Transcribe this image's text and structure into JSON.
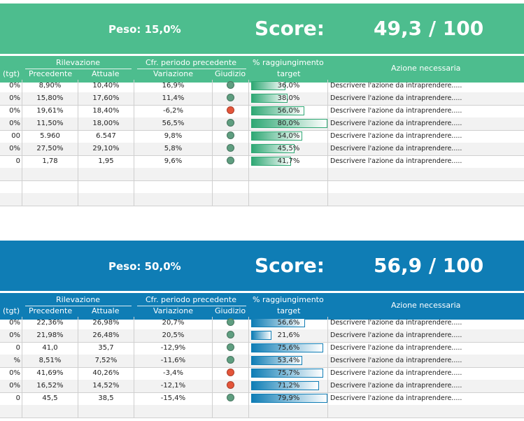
{
  "sections": [
    {
      "banner_color": "#4dbd8e",
      "header_color": "#4dbd8e",
      "peso": "Peso: 15,0%",
      "score_label": "Score:",
      "score_value": "49,3 / 100",
      "headers": {
        "col0": "(tgt)",
        "rilevazione": "Rilevazione",
        "precedente": "Precedente",
        "attuale": "Attuale",
        "cfr": "Cfr. periodo precedente",
        "variazione": "Variazione",
        "giudizio": "Giudizio",
        "perc_line1": "% raggiungimento",
        "perc_line2": "target",
        "azione": "Azione necessaria"
      },
      "rows": [
        {
          "tgt": "0%",
          "prec": "8,90%",
          "att": "10,40%",
          "var": "16,9%",
          "judg": "green",
          "pct": 0.36,
          "pct_label": "36,0%",
          "action": "Descrivere l'azione da intraprendere....."
        },
        {
          "tgt": "0%",
          "prec": "15,80%",
          "att": "17,60%",
          "var": "11,4%",
          "judg": "green",
          "pct": 0.38,
          "pct_label": "38,0%",
          "action": "Descrivere l'azione da intraprendere....."
        },
        {
          "tgt": "0%",
          "prec": "19,61%",
          "att": "18,40%",
          "var": "-6,2%",
          "judg": "red",
          "pct": 0.56,
          "pct_label": "56,0%",
          "action": "Descrivere l'azione da intraprendere....."
        },
        {
          "tgt": "0%",
          "prec": "11,50%",
          "att": "18,00%",
          "var": "56,5%",
          "judg": "green",
          "pct": 0.8,
          "pct_label": "80,0%",
          "action": "Descrivere l'azione da intraprendere....."
        },
        {
          "tgt": "00",
          "prec": "5.960",
          "att": "6.547",
          "var": "9,8%",
          "judg": "green",
          "pct": 0.54,
          "pct_label": "54,0%",
          "action": "Descrivere l'azione da intraprendere....."
        },
        {
          "tgt": "0%",
          "prec": "27,50%",
          "att": "29,10%",
          "var": "5,8%",
          "judg": "green",
          "pct": 0.455,
          "pct_label": "45,5%",
          "action": "Descrivere l'azione da intraprendere....."
        },
        {
          "tgt": "0",
          "prec": "1,78",
          "att": "1,95",
          "var": "9,6%",
          "judg": "green",
          "pct": 0.417,
          "pct_label": "41,7%",
          "action": "Descrivere l'azione da intraprendere....."
        }
      ],
      "empty_rows": 3
    },
    {
      "banner_color": "#0f7db5",
      "header_color": "#0f7db5",
      "peso": "Peso: 50,0%",
      "score_label": "Score:",
      "score_value": "56,9 / 100",
      "headers": {
        "col0": "(tgt)",
        "rilevazione": "Rilevazione",
        "precedente": "Precedente",
        "attuale": "Attuale",
        "cfr": "Cfr. periodo precedente",
        "variazione": "Variazione",
        "giudizio": "Giudizio",
        "perc_line1": "% raggiungimento",
        "perc_line2": "target",
        "azione": "Azione necessaria"
      },
      "rows": [
        {
          "tgt": "0%",
          "prec": "22,36%",
          "att": "26,98%",
          "var": "20,7%",
          "judg": "green",
          "pct": 0.566,
          "pct_label": "56,6%",
          "action": "Descrivere l'azione da intraprendere....."
        },
        {
          "tgt": "0%",
          "prec": "21,98%",
          "att": "26,48%",
          "var": "20,5%",
          "judg": "green",
          "pct": 0.216,
          "pct_label": "21,6%",
          "action": "Descrivere l'azione da intraprendere....."
        },
        {
          "tgt": "0",
          "prec": "41,0",
          "att": "35,7",
          "var": "-12,9%",
          "judg": "green",
          "pct": 0.756,
          "pct_label": "75,6%",
          "action": "Descrivere l'azione da intraprendere....."
        },
        {
          "tgt": "%",
          "prec": "8,51%",
          "att": "7,52%",
          "var": "-11,6%",
          "judg": "green",
          "pct": 0.534,
          "pct_label": "53,4%",
          "action": "Descrivere l'azione da intraprendere....."
        },
        {
          "tgt": "0%",
          "prec": "41,69%",
          "att": "40,26%",
          "var": "-3,4%",
          "judg": "red",
          "pct": 0.757,
          "pct_label": "75,7%",
          "action": "Descrivere l'azione da intraprendere....."
        },
        {
          "tgt": "0%",
          "prec": "16,52%",
          "att": "14,52%",
          "var": "-12,1%",
          "judg": "red",
          "pct": 0.712,
          "pct_label": "71,2%",
          "action": "Descrivere l'azione da intraprendere....."
        },
        {
          "tgt": "0",
          "prec": "45,5",
          "att": "38,5",
          "var": "-15,4%",
          "judg": "green",
          "pct": 0.799,
          "pct_label": "79,9%",
          "action": "Descrivere l'azione da intraprendere....."
        }
      ],
      "empty_rows": 1
    }
  ],
  "colors": {
    "judg_green": "#5f9e80",
    "judg_red": "#e4553a",
    "bar_green_start": "#2fa874",
    "bar_green_end": "#ffffff",
    "bar_blue_start": "#0f7db5",
    "bar_blue_end": "#ffffff"
  }
}
